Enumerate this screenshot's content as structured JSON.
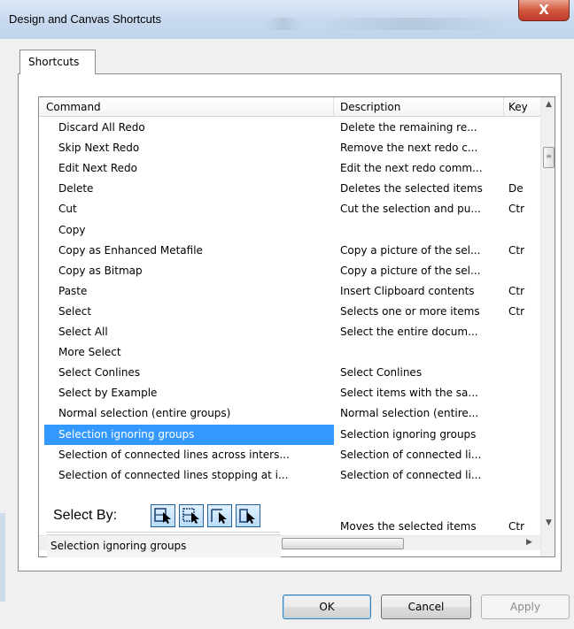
{
  "window": {
    "title": "Design and Canvas Shortcuts",
    "close_label": "X"
  },
  "tabs": [
    {
      "label": "Shortcuts"
    }
  ],
  "list": {
    "columns": [
      "Command",
      "Description",
      "Key"
    ],
    "rows": [
      {
        "command": "Discard All Redo",
        "description": "Delete the remaining re...",
        "key": ""
      },
      {
        "command": "Skip Next Redo",
        "description": "Remove the next redo c...",
        "key": ""
      },
      {
        "command": "Edit Next Redo",
        "description": "Edit the next redo comm...",
        "key": ""
      },
      {
        "command": "Delete",
        "description": "Deletes the selected items",
        "key": "De"
      },
      {
        "command": "Cut",
        "description": "Cut the selection and pu...",
        "key": "Ctr"
      },
      {
        "command": "Copy",
        "description": "",
        "key": ""
      },
      {
        "command": "Copy as Enhanced Metafile",
        "description": "Copy a picture of the sel...",
        "key": "Ctr"
      },
      {
        "command": "Copy as Bitmap",
        "description": "Copy a picture of the sel...",
        "key": ""
      },
      {
        "command": "Paste",
        "description": "Insert Clipboard contents",
        "key": "Ctr"
      },
      {
        "command": "Select",
        "description": "Selects one or more items",
        "key": "Ctr"
      },
      {
        "command": "Select All",
        "description": "Select the entire docum...",
        "key": ""
      },
      {
        "command": "More Select",
        "description": "",
        "key": ""
      },
      {
        "command": "Select Conlines",
        "description": "Select Conlines",
        "key": ""
      },
      {
        "command": "Select by Example",
        "description": "Select items with the sa...",
        "key": ""
      },
      {
        "command": "Normal selection (entire groups)",
        "description": "Normal selection (entire...",
        "key": ""
      },
      {
        "command": "Selection ignoring groups",
        "description": "Selection ignoring groups",
        "key": ""
      },
      {
        "command": "Selection of connected lines across inters...",
        "description": "Selection of connected li...",
        "key": ""
      },
      {
        "command": "Selection of connected lines stopping at i...",
        "description": "Selection of connected li...",
        "key": ""
      },
      {
        "command": "",
        "description": "Moves the selected items",
        "key": "Ctr"
      }
    ]
  },
  "selectby": {
    "label": "Select By:"
  },
  "tooltip": "Selection ignoring groups",
  "buttons": {
    "ok": "OK",
    "cancel": "Cancel",
    "apply": "Apply"
  },
  "colors": {
    "selection": "#3399ff",
    "close_button": "#c0392b"
  }
}
